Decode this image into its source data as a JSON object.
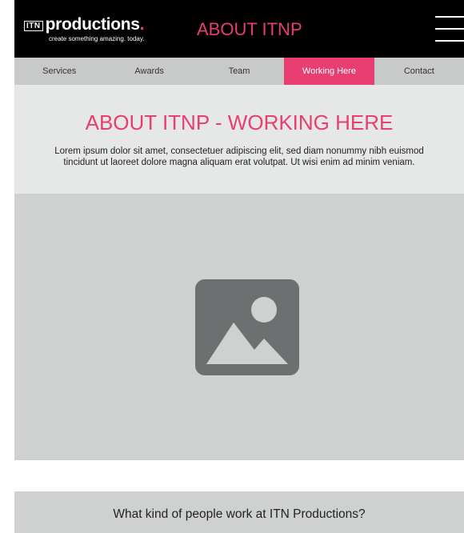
{
  "header": {
    "logo_badge": "ITN",
    "logo_word": "productions",
    "logo_dot": ".",
    "tagline": "create something amazing. today.",
    "title": "ABOUT ITNP",
    "menu_icon": "hamburger-menu-icon"
  },
  "nav": {
    "items": [
      {
        "label": "Services"
      },
      {
        "label": "Awards"
      },
      {
        "label": "Team"
      },
      {
        "label": "Working Here",
        "active": true
      },
      {
        "label": "Contact"
      }
    ]
  },
  "intro": {
    "title": "ABOUT ITNP - WORKING HERE",
    "text_line1": "Lorem ipsum dolor sit amet, consectetuer adipiscing elit, sed diam nonummy nibh euismod",
    "text_line2": "tincidunt ut laoreet dolore magna aliquam erat volutpat. Ut wisi enim ad minim veniam."
  },
  "media": {
    "icon": "image-placeholder-icon"
  },
  "question": {
    "text": "What kind of people work at ITN Productions?"
  },
  "colors": {
    "accent": "#e83e72",
    "header_bg": "#000000",
    "nav_bg": "#c8c9c9",
    "intro_bg": "#e6e7e7",
    "media_bg": "#cfd1d1",
    "icon_fill": "#6d7070"
  }
}
